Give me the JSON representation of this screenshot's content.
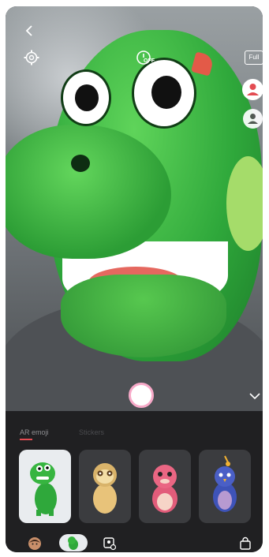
{
  "camera_overlay": {
    "timer_status": "OFF",
    "full_label": "Full"
  },
  "sticker_tray": {
    "tabs": [
      {
        "label": "AR emoji"
      },
      {
        "label": "Stickers"
      }
    ],
    "selected_tab_index": 0,
    "items": [
      {
        "name": "dino",
        "selected": true
      },
      {
        "name": "sloth",
        "selected": false
      },
      {
        "name": "pink-creature",
        "selected": false
      },
      {
        "name": "blue-bird",
        "selected": false
      }
    ]
  },
  "bottom_bar": {
    "items": [
      {
        "icon": "my-emoji-avatar-icon"
      },
      {
        "icon": "dino-emoji-icon"
      },
      {
        "icon": "emoji-settings-icon"
      },
      {
        "icon": "store-bag-icon"
      }
    ]
  },
  "colors": {
    "accent": "#e34c52",
    "shutter_ring": "#f7a9c8",
    "tray_bg": "#202022"
  }
}
